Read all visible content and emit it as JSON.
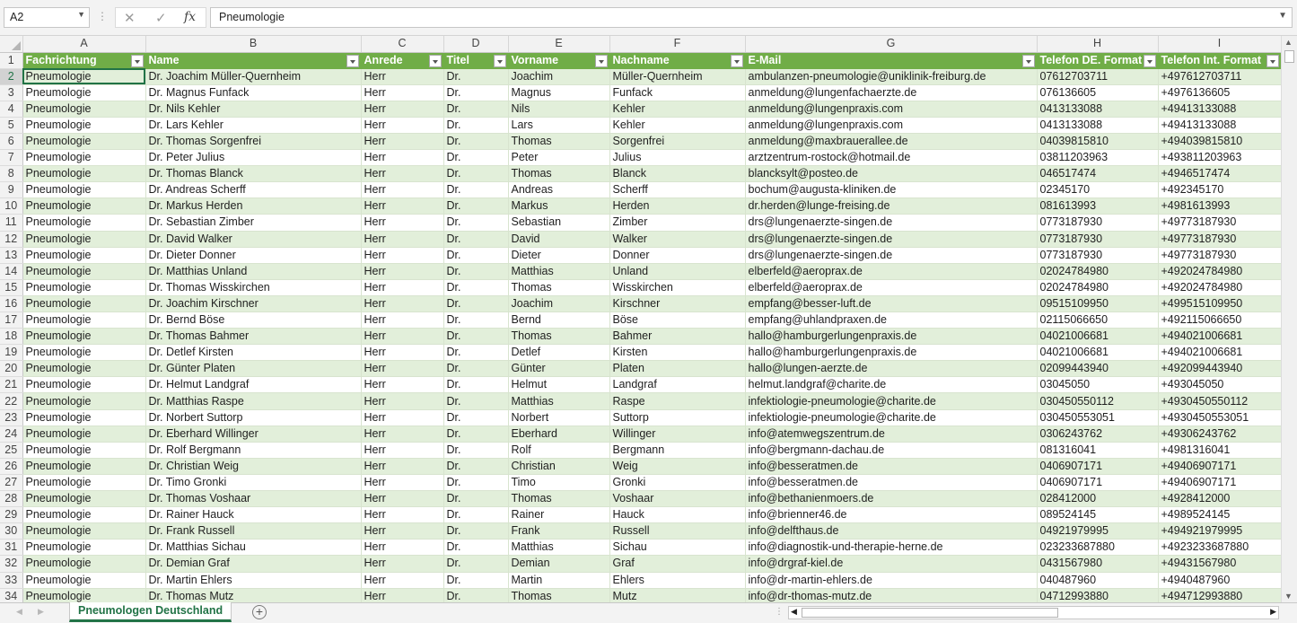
{
  "formula_bar": {
    "name_box": "A2",
    "cancel_icon": "✕",
    "enter_icon": "✓",
    "fx_label": "fx",
    "content": "Pneumologie"
  },
  "columns": [
    "A",
    "B",
    "C",
    "D",
    "E",
    "F",
    "G",
    "H",
    "I"
  ],
  "headers": [
    "Fachrichtung",
    "Name",
    "Anrede",
    "Titel",
    "Vorname",
    "Nachname",
    "E-Mail",
    "Telefon DE. Format",
    "Telefon Int. Format"
  ],
  "rows": [
    [
      "2",
      "Pneumologie",
      "Dr. Joachim Müller-Quernheim",
      "Herr",
      "Dr.",
      "Joachim",
      "Müller-Quernheim",
      "ambulanzen-pneumologie@uniklinik-freiburg.de",
      "07612703711",
      "+497612703711"
    ],
    [
      "3",
      "Pneumologie",
      "Dr. Magnus Funfack",
      "Herr",
      "Dr.",
      "Magnus",
      "Funfack",
      "anmeldung@lungenfachaerzte.de",
      "076136605",
      "+4976136605"
    ],
    [
      "4",
      "Pneumologie",
      "Dr. Nils Kehler",
      "Herr",
      "Dr.",
      "Nils",
      "Kehler",
      "anmeldung@lungenpraxis.com",
      "0413133088",
      "+49413133088"
    ],
    [
      "5",
      "Pneumologie",
      "Dr. Lars Kehler",
      "Herr",
      "Dr.",
      "Lars",
      "Kehler",
      "anmeldung@lungenpraxis.com",
      "0413133088",
      "+49413133088"
    ],
    [
      "6",
      "Pneumologie",
      "Dr. Thomas Sorgenfrei",
      "Herr",
      "Dr.",
      "Thomas",
      "Sorgenfrei",
      "anmeldung@maxbrauerallee.de",
      "04039815810",
      "+494039815810"
    ],
    [
      "7",
      "Pneumologie",
      "Dr. Peter Julius",
      "Herr",
      "Dr.",
      "Peter",
      "Julius",
      "arztzentrum-rostock@hotmail.de",
      "03811203963",
      "+493811203963"
    ],
    [
      "8",
      "Pneumologie",
      "Dr. Thomas Blanck",
      "Herr",
      "Dr.",
      "Thomas",
      "Blanck",
      "blancksylt@posteo.de",
      "046517474",
      "+4946517474"
    ],
    [
      "9",
      "Pneumologie",
      "Dr. Andreas Scherff",
      "Herr",
      "Dr.",
      "Andreas",
      "Scherff",
      "bochum@augusta-kliniken.de",
      "02345170",
      "+492345170"
    ],
    [
      "10",
      "Pneumologie",
      "Dr. Markus Herden",
      "Herr",
      "Dr.",
      "Markus",
      "Herden",
      "dr.herden@lunge-freising.de",
      "081613993",
      "+4981613993"
    ],
    [
      "11",
      "Pneumologie",
      "Dr. Sebastian Zimber",
      "Herr",
      "Dr.",
      "Sebastian",
      "Zimber",
      "drs@lungenaerzte-singen.de",
      "0773187930",
      "+49773187930"
    ],
    [
      "12",
      "Pneumologie",
      "Dr. David Walker",
      "Herr",
      "Dr.",
      "David",
      "Walker",
      "drs@lungenaerzte-singen.de",
      "0773187930",
      "+49773187930"
    ],
    [
      "13",
      "Pneumologie",
      "Dr. Dieter Donner",
      "Herr",
      "Dr.",
      "Dieter",
      "Donner",
      "drs@lungenaerzte-singen.de",
      "0773187930",
      "+49773187930"
    ],
    [
      "14",
      "Pneumologie",
      "Dr. Matthias Unland",
      "Herr",
      "Dr.",
      "Matthias",
      "Unland",
      "elberfeld@aeroprax.de",
      "02024784980",
      "+492024784980"
    ],
    [
      "15",
      "Pneumologie",
      "Dr. Thomas Wisskirchen",
      "Herr",
      "Dr.",
      "Thomas",
      "Wisskirchen",
      "elberfeld@aeroprax.de",
      "02024784980",
      "+492024784980"
    ],
    [
      "16",
      "Pneumologie",
      "Dr. Joachim Kirschner",
      "Herr",
      "Dr.",
      "Joachim",
      "Kirschner",
      "empfang@besser-luft.de",
      "09515109950",
      "+499515109950"
    ],
    [
      "17",
      "Pneumologie",
      "Dr. Bernd Böse",
      "Herr",
      "Dr.",
      "Bernd",
      "Böse",
      "empfang@uhlandpraxen.de",
      "02115066650",
      "+492115066650"
    ],
    [
      "18",
      "Pneumologie",
      "Dr. Thomas Bahmer",
      "Herr",
      "Dr.",
      "Thomas",
      "Bahmer",
      "hallo@hamburgerlungenpraxis.de",
      "04021006681",
      "+494021006681"
    ],
    [
      "19",
      "Pneumologie",
      "Dr. Detlef Kirsten",
      "Herr",
      "Dr.",
      "Detlef",
      "Kirsten",
      "hallo@hamburgerlungenpraxis.de",
      "04021006681",
      "+494021006681"
    ],
    [
      "20",
      "Pneumologie",
      "Dr. Günter Platen",
      "Herr",
      "Dr.",
      "Günter",
      "Platen",
      "hallo@lungen-aerzte.de",
      "02099443940",
      "+492099443940"
    ],
    [
      "21",
      "Pneumologie",
      "Dr. Helmut Landgraf",
      "Herr",
      "Dr.",
      "Helmut",
      "Landgraf",
      "helmut.landgraf@charite.de",
      "03045050",
      "+493045050"
    ],
    [
      "22",
      "Pneumologie",
      "Dr. Matthias Raspe",
      "Herr",
      "Dr.",
      "Matthias",
      "Raspe",
      "infektiologie-pneumologie@charite.de",
      "030450550112",
      "+4930450550112"
    ],
    [
      "23",
      "Pneumologie",
      "Dr. Norbert Suttorp",
      "Herr",
      "Dr.",
      "Norbert",
      "Suttorp",
      "infektiologie-pneumologie@charite.de",
      "030450553051",
      "+4930450553051"
    ],
    [
      "24",
      "Pneumologie",
      "Dr. Eberhard Willinger",
      "Herr",
      "Dr.",
      "Eberhard",
      "Willinger",
      "info@atemwegszentrum.de",
      "0306243762",
      "+49306243762"
    ],
    [
      "25",
      "Pneumologie",
      "Dr. Rolf Bergmann",
      "Herr",
      "Dr.",
      "Rolf",
      "Bergmann",
      "info@bergmann-dachau.de",
      "081316041",
      "+4981316041"
    ],
    [
      "26",
      "Pneumologie",
      "Dr. Christian Weig",
      "Herr",
      "Dr.",
      "Christian",
      "Weig",
      "info@besseratmen.de",
      "0406907171",
      "+49406907171"
    ],
    [
      "27",
      "Pneumologie",
      "Dr. Timo Gronki",
      "Herr",
      "Dr.",
      "Timo",
      "Gronki",
      "info@besseratmen.de",
      "0406907171",
      "+49406907171"
    ],
    [
      "28",
      "Pneumologie",
      "Dr. Thomas Voshaar",
      "Herr",
      "Dr.",
      "Thomas",
      "Voshaar",
      "info@bethanienmoers.de",
      "028412000",
      "+4928412000"
    ],
    [
      "29",
      "Pneumologie",
      "Dr. Rainer Hauck",
      "Herr",
      "Dr.",
      "Rainer",
      "Hauck",
      "info@brienner46.de",
      "089524145",
      "+4989524145"
    ],
    [
      "30",
      "Pneumologie",
      "Dr. Frank Russell",
      "Herr",
      "Dr.",
      "Frank",
      "Russell",
      "info@delfthaus.de",
      "04921979995",
      "+494921979995"
    ],
    [
      "31",
      "Pneumologie",
      "Dr. Matthias Sichau",
      "Herr",
      "Dr.",
      "Matthias",
      "Sichau",
      "info@diagnostik-und-therapie-herne.de",
      "023233687880",
      "+4923233687880"
    ],
    [
      "32",
      "Pneumologie",
      "Dr. Demian Graf",
      "Herr",
      "Dr.",
      "Demian",
      "Graf",
      "info@drgraf-kiel.de",
      "0431567980",
      "+49431567980"
    ],
    [
      "33",
      "Pneumologie",
      "Dr. Martin Ehlers",
      "Herr",
      "Dr.",
      "Martin",
      "Ehlers",
      "info@dr-martin-ehlers.de",
      "040487960",
      "+4940487960"
    ],
    [
      "34",
      "Pneumologie",
      "Dr. Thomas Mutz",
      "Herr",
      "Dr.",
      "Thomas",
      "Mutz",
      "info@dr-thomas-mutz.de",
      "04712993880",
      "+494712993880"
    ]
  ],
  "sheet_tab": "Pneumologen Deutschland",
  "add_sheet": "+",
  "colors": {
    "accent": "#217346",
    "header": "#70ad47",
    "band": "#e2efda"
  },
  "icons": {
    "cancel": "close-icon",
    "enter": "check-icon",
    "fx": "function-icon",
    "add_sheet": "plus-circle-icon",
    "filter": "dropdown-filter-icon"
  }
}
